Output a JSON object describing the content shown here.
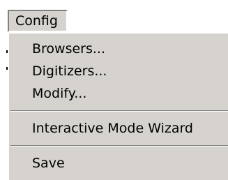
{
  "menubar": {
    "config_label": "Config"
  },
  "menu": {
    "items": [
      {
        "label": "Browsers..."
      },
      {
        "label": "Digitizers..."
      },
      {
        "label": "Modify..."
      },
      {
        "label": "Interactive Mode Wizard"
      },
      {
        "label": "Save"
      }
    ]
  },
  "colors": {
    "menu_face": "#d6d3ce",
    "shadow": "#808080",
    "highlight": "#ffffff",
    "text": "#000000"
  }
}
